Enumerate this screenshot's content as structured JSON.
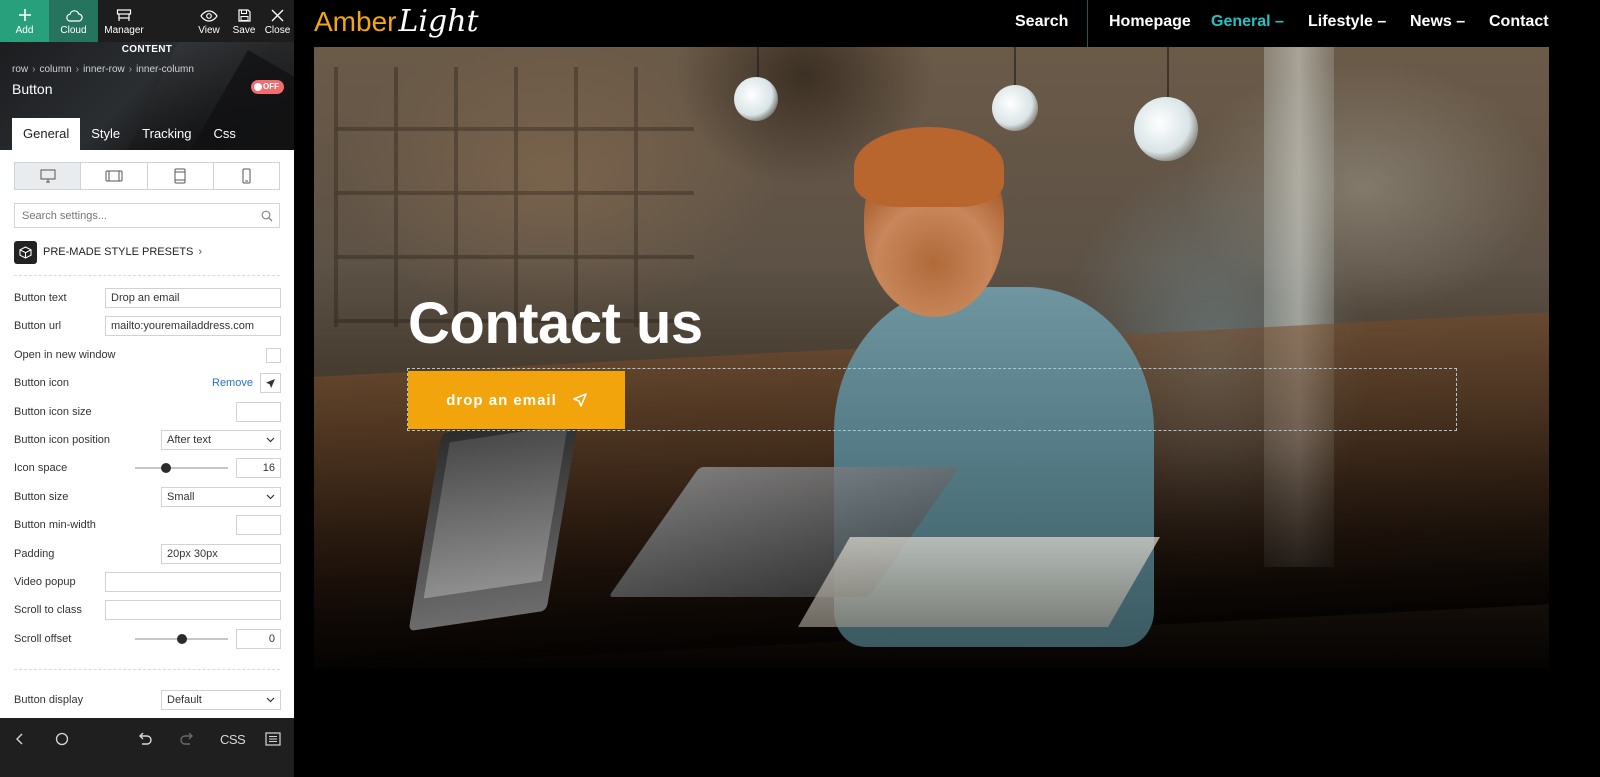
{
  "toolbar": {
    "add": "Add",
    "cloud": "Cloud",
    "manager": "Manager",
    "view": "View",
    "save": "Save",
    "close": "Close"
  },
  "panel": {
    "section_label": "CONTENT",
    "breadcrumb": [
      "row",
      "column",
      "inner-row",
      "inner-column"
    ],
    "element_title": "Button",
    "toggle_label": "OFF",
    "tabs": [
      "General",
      "Style",
      "Tracking",
      "Css"
    ],
    "active_tab": "General",
    "devices": [
      "desktop-icon",
      "tablet-landscape-icon",
      "tablet-portrait-icon",
      "mobile-icon"
    ],
    "search_placeholder": "Search settings...",
    "presets_label": "PRE-MADE STYLE PRESETS",
    "fields": {
      "button_text": {
        "label": "Button text",
        "value": "Drop an email"
      },
      "button_url": {
        "label": "Button url",
        "value": "mailto:youremailaddress.com"
      },
      "open_new_window": {
        "label": "Open in new window",
        "checked": false
      },
      "button_icon": {
        "label": "Button icon",
        "action": "Remove",
        "icon": "send-icon"
      },
      "button_icon_size": {
        "label": "Button icon size",
        "value": ""
      },
      "button_icon_position": {
        "label": "Button icon position",
        "value": "After text"
      },
      "icon_space": {
        "label": "Icon space",
        "value": "16",
        "slider_fraction": 0.33
      },
      "button_size": {
        "label": "Button size",
        "value": "Small"
      },
      "button_min_width": {
        "label": "Button min-width",
        "value": ""
      },
      "padding": {
        "label": "Padding",
        "value": "20px 30px"
      },
      "video_popup": {
        "label": "Video popup",
        "value": ""
      },
      "scroll_to_class": {
        "label": "Scroll to class",
        "value": ""
      },
      "scroll_offset": {
        "label": "Scroll offset",
        "value": "0",
        "slider_fraction": 0.5
      },
      "button_display": {
        "label": "Button display",
        "value": "Default"
      }
    }
  },
  "bottombar": {
    "css_label": "CSS"
  },
  "site": {
    "logo_primary": "Amber",
    "logo_secondary": "Light",
    "nav": [
      {
        "label": "Search"
      },
      {
        "label": "Homepage"
      },
      {
        "label": "General –",
        "active": true
      },
      {
        "label": "Lifestyle –"
      },
      {
        "label": "News –"
      },
      {
        "label": "Contact"
      }
    ],
    "hero_title": "Contact us",
    "cta_label": "drop an email"
  },
  "colors": {
    "accent_green": "#28a07c",
    "cta_orange": "#f2a40d",
    "nav_active": "#24c2c2",
    "logo_amber": "#f2a516"
  }
}
